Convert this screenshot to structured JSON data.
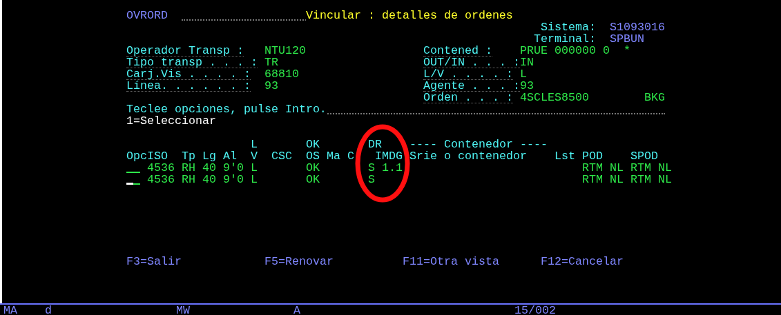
{
  "program": "OVRORD",
  "title": "Vincular : detalles de ordenes",
  "system": [
    {
      "label": "Sistema:",
      "value": "S1093016"
    },
    {
      "label": "Terminal:",
      "value": "SPBUN"
    }
  ],
  "left_fields": [
    {
      "label": "Operador Transp :",
      "value": "NTU120"
    },
    {
      "label": "Tipo transp . . . :",
      "value": "TR"
    },
    {
      "label": "Carj.Vis . . . . :",
      "value": "68810"
    },
    {
      "label": "Línea. . . . . . :",
      "value": "93"
    }
  ],
  "right_fields": [
    {
      "label": "Contened :",
      "value": "PRUE 000000 0  *"
    },
    {
      "label": "OUT/IN . . . :",
      "value": "IN"
    },
    {
      "label": "L/V . . . . :",
      "value": "L"
    },
    {
      "label": "Agente . . . :",
      "value": "93"
    },
    {
      "label": "Orden . . . :",
      "value": "4SCLES8500",
      "extra": "BKG"
    }
  ],
  "instruction": "Teclee opciones, pulse Intro.",
  "options": "1=Seleccionar",
  "header_top": [
    "L",
    "OK",
    "DR",
    "---- Contenedor ----"
  ],
  "header": [
    "Opc",
    "ISO",
    "Tp",
    "Lg",
    "Al",
    "V",
    "CSC",
    "OS",
    "Ma",
    "C",
    "IMDG",
    "S",
    "rie o contenedor",
    "Lst",
    "POD",
    "SPOD"
  ],
  "rows": [
    {
      "focused": false,
      "cells": {
        "iso": "4536",
        "tp": "RH",
        "lg": "40",
        "al": "9'0",
        "lv": "L",
        "ok": "OK",
        "dr": "S",
        "imdg": "1.1",
        "pod": "RTM",
        "pod_cc": "NL",
        "spod": "RTM",
        "spod_cc": "NL"
      }
    },
    {
      "focused": true,
      "cells": {
        "iso": "4536",
        "tp": "RH",
        "lg": "40",
        "al": "9'0",
        "lv": "L",
        "ok": "OK",
        "dr": "S",
        "pod": "RTM",
        "pod_cc": "NL",
        "spod": "RTM",
        "spod_cc": "NL"
      }
    }
  ],
  "function_keys": [
    "F3=Salir",
    "F5=Renovar",
    "F11=Otra vista",
    "F12=Cancelar"
  ],
  "status_bar": [
    "MA",
    "d",
    "MW",
    "A",
    "15/002"
  ]
}
